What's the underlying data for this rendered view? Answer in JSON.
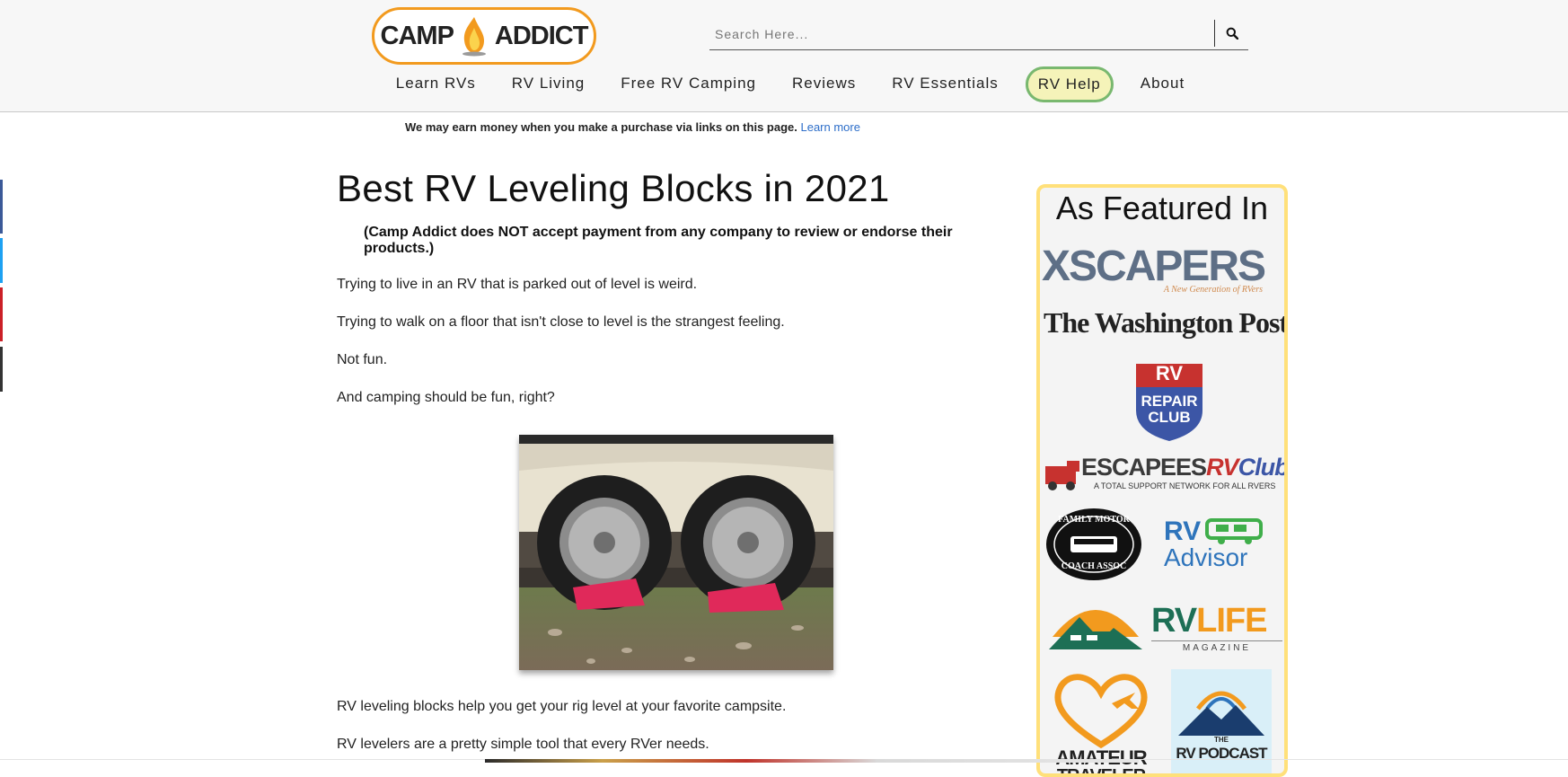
{
  "header": {
    "logo_left": "CAMP",
    "logo_right": "ADDICT",
    "search": {
      "placeholder": "Search Here..."
    },
    "nav": [
      {
        "label": "Learn RVs"
      },
      {
        "label": "RV Living"
      },
      {
        "label": "Free RV Camping"
      },
      {
        "label": "Reviews"
      },
      {
        "label": "RV Essentials"
      },
      {
        "label": "RV Help"
      },
      {
        "label": "About"
      }
    ]
  },
  "disclosure": {
    "text": "We may earn money when you make a purchase via links on this page.",
    "link": "Learn more"
  },
  "article": {
    "title": "Best RV Leveling Blocks in 2021",
    "notice": "(Camp Addict does NOT accept payment from any company to review or endorse their products.)",
    "paragraphs": [
      "Trying to live in an RV that is parked out of level is weird.",
      "Trying to walk on a floor that isn't close to level is the strangest feeling.",
      "Not fun.",
      "And camping should be fun, right?"
    ],
    "after_image": [
      "RV leveling blocks help you get your rig level at your favorite campsite.",
      "RV levelers are a pretty simple tool that every RVer needs."
    ]
  },
  "featured": {
    "heading": "As Featured In",
    "logos": {
      "xscapers": "XSCAPERS",
      "xscapers_tag": "A New Generation of RVers",
      "wapo": "The Washington Post",
      "rv_repair_top": "RV",
      "rv_repair_1": "REPAIR",
      "rv_repair_2": "CLUB",
      "escapees": "ESCAPEES",
      "escapees_rv": "RV",
      "escapees_club": "Club",
      "escapees_tag": "A TOTAL SUPPORT NETWORK FOR ALL RVERS",
      "fmca_top": "FAMILY MOTOR",
      "fmca_bottom": "COACH ASSOC",
      "rvadvisor_1": "RV",
      "rvadvisor_2": "Advisor",
      "rvlife_1": "RV",
      "rvlife_2": "LIFE",
      "rvlife_3": "MAGAZINE",
      "amateur_1": "AMATEUR",
      "amateur_2": "TRAVELER",
      "podcast_1": "THE",
      "podcast_2": "RV PODCAST"
    }
  },
  "colors": {
    "header_bg": "#f7f7f7",
    "logo_orange": "#f29a1e",
    "rv_help_fill": "#f5f3b9",
    "rv_help_border": "#79b86f",
    "featured_border": "#ffe07a",
    "link_blue": "#2d6ec9",
    "social_facebook": "#3b5998",
    "social_twitter": "#1da1f2",
    "social_pinterest": "#cb2027",
    "social_other": "#333333"
  }
}
